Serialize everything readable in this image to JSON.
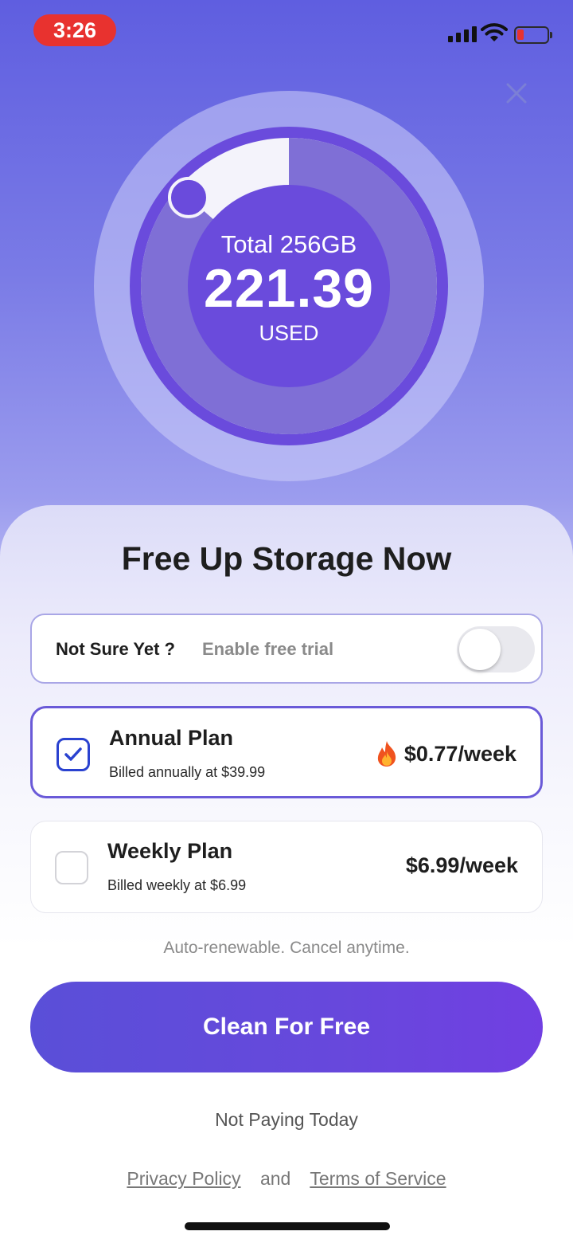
{
  "status_bar": {
    "time": "3:26"
  },
  "gauge": {
    "total_label": "Total 256GB",
    "used_value": "221.39",
    "used_label": "USED",
    "used_fraction": 0.865,
    "colors": {
      "ring": "#6a4bdc",
      "track": "#f4f3fb",
      "halo": "#cdcffa"
    }
  },
  "sheet": {
    "title": "Free Up Storage Now",
    "trial": {
      "question": "Not Sure Yet ?",
      "label": "Enable free trial",
      "enabled": false
    },
    "plans": [
      {
        "name": "Annual Plan",
        "billed": "Billed annually at $39.99",
        "price": "$0.77/week",
        "selected": true,
        "icon": "fire-icon"
      },
      {
        "name": "Weekly Plan",
        "billed": "Billed weekly at $6.99",
        "price": "$6.99/week",
        "selected": false
      }
    ],
    "renew_note": "Auto-renewable. Cancel anytime.",
    "cta_label": "Clean For Free",
    "not_paying": "Not Paying Today",
    "legal": {
      "privacy": "Privacy Policy",
      "and": "and",
      "terms": "Terms of Service"
    }
  },
  "colors": {
    "accent": "#6a4bdc",
    "checkbox": "#2a42d0",
    "badge_red": "#e8322f"
  }
}
